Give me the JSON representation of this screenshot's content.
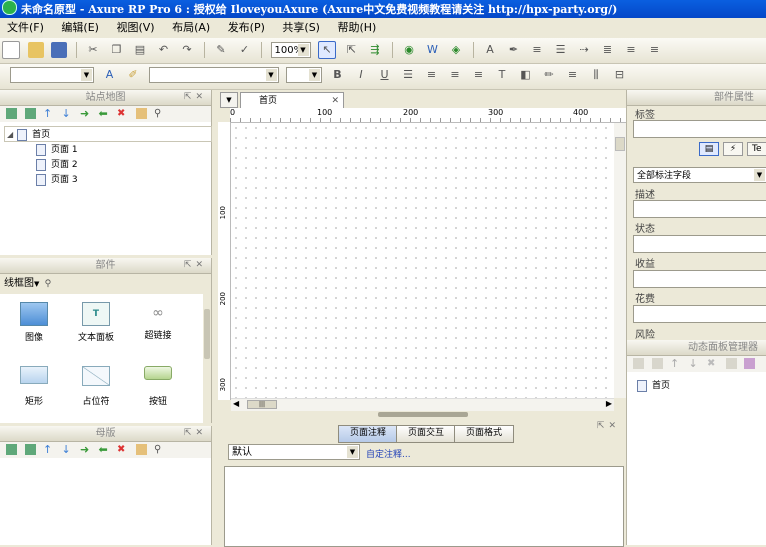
{
  "window": {
    "title": "未命名原型 - Axure RP Pro 6 : 授权给 IloveyouAxure (Axure中文免费视频教程请关注 http://hpx-party.org/)"
  },
  "menu": {
    "items": [
      "文件(F)",
      "编辑(E)",
      "视图(V)",
      "布局(A)",
      "发布(P)",
      "共享(S)",
      "帮助(H)"
    ]
  },
  "toolbar": {
    "zoom": "100%"
  },
  "sitemap": {
    "title": "站点地图",
    "home": "首页",
    "pages": [
      "页面 1",
      "页面 2",
      "页面 3"
    ]
  },
  "widgets": {
    "title": "部件",
    "library": "线框图",
    "items": [
      {
        "label": "图像",
        "icon": "image-icon"
      },
      {
        "label": "文本面板",
        "icon": "text-panel-icon"
      },
      {
        "label": "超链接",
        "icon": "hyperlink-icon"
      },
      {
        "label": "矩形",
        "icon": "rectangle-icon"
      },
      {
        "label": "占位符",
        "icon": "placeholder-icon"
      },
      {
        "label": "按钮",
        "icon": "button-icon"
      }
    ]
  },
  "masters": {
    "title": "母版"
  },
  "canvas": {
    "tab_label": "首页",
    "ruler_marks": [
      "0",
      "100",
      "200",
      "300",
      "400"
    ],
    "vruler_marks": [
      "100",
      "200",
      "300"
    ]
  },
  "page_props": {
    "tabs": [
      "页面注释",
      "页面交互",
      "页面格式"
    ],
    "notes_select": "默认",
    "customize_link": "自定注释..."
  },
  "widget_props": {
    "title": "部件属性",
    "label_field": "标签",
    "select": "全部标注字段",
    "fields": [
      "描述",
      "状态",
      "收益",
      "花费",
      "风险"
    ],
    "icons": [
      "notes-icon",
      "interaction-icon",
      "text-format-icon"
    ],
    "text_tab": "Te"
  },
  "dynamic_panel": {
    "title": "动态面板管理器",
    "home": "首页"
  },
  "colors": {
    "titlebar": "#0a5fe0",
    "chrome": "#ece9d8"
  }
}
